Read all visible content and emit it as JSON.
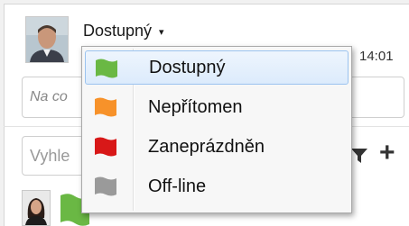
{
  "status": {
    "current": "Dostupný",
    "caret": "▾"
  },
  "time": "14:01",
  "note": {
    "placeholder": "Na co"
  },
  "search": {
    "placeholder": "Vyhle"
  },
  "add_label": "+",
  "colors": {
    "available": "#6ab844",
    "away": "#f7922a",
    "busy": "#d81818",
    "offline": "#9a9a9a",
    "selection": "#dcebfc"
  },
  "menu": {
    "items": [
      {
        "label": "Dostupný",
        "icon": "green-flag-icon"
      },
      {
        "label": "Nepřítomen",
        "icon": "orange-flag-icon"
      },
      {
        "label": "Zaneprázdněn",
        "icon": "red-flag-icon"
      },
      {
        "label": "Off-line",
        "icon": "gray-flag-icon"
      }
    ]
  }
}
